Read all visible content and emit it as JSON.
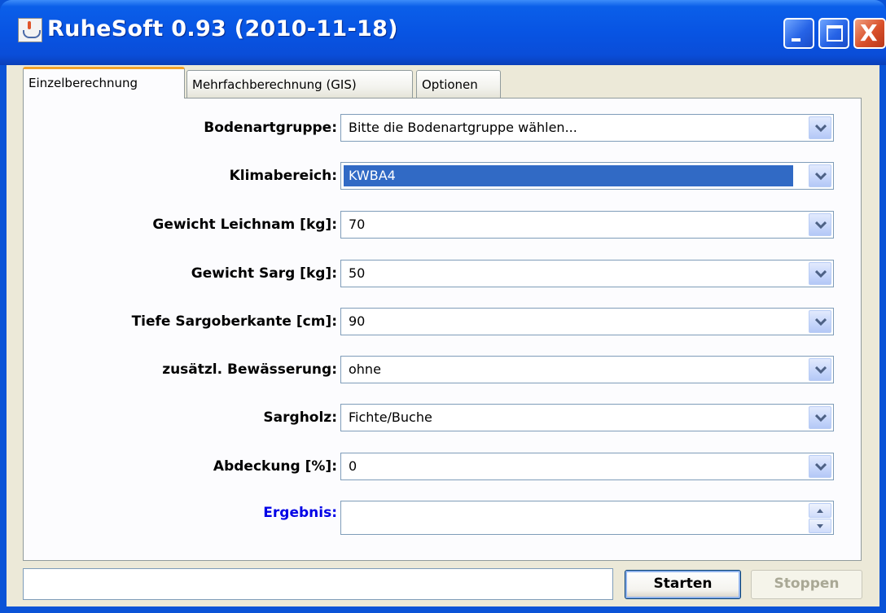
{
  "window": {
    "title": "RuheSoft 0.93 (2010-11-18)",
    "icon": "java-cup-icon",
    "controls": [
      "minimize",
      "maximize",
      "close"
    ],
    "close_glyph": "X"
  },
  "tabs": [
    {
      "label": "Einzelberechnung",
      "active": true
    },
    {
      "label": "Mehrfachberechnung (GIS)",
      "active": false
    },
    {
      "label": "Optionen",
      "active": false
    }
  ],
  "form": {
    "bodenartgruppe": {
      "label": "Bodenartgruppe:",
      "value": "Bitte die Bodenartgruppe wählen..."
    },
    "klimabereich": {
      "label": "Klimabereich:",
      "value": "KWBA4"
    },
    "gewicht_leichnam": {
      "label": "Gewicht Leichnam [kg]:",
      "value": "70"
    },
    "gewicht_sarg": {
      "label": "Gewicht Sarg [kg]:",
      "value": "50"
    },
    "tiefe_sargoberkante": {
      "label": "Tiefe Sargoberkante [cm]:",
      "value": "90"
    },
    "bewaesserung": {
      "label": "zusätzl. Bewässerung:",
      "value": "ohne"
    },
    "sargholz": {
      "label": "Sargholz:",
      "value": "Fichte/Buche"
    },
    "abdeckung": {
      "label": "Abdeckung [%]:",
      "value": "0"
    },
    "ergebnis": {
      "label": "Ergebnis:",
      "value": ""
    }
  },
  "footer": {
    "status_text": "",
    "start_label": "Starten",
    "stop_label": "Stoppen",
    "stop_enabled": false
  },
  "colors": {
    "titlebar": "#0a53d7",
    "selection": "#316ac5",
    "active_tab_accent": "#f3a32b",
    "ergebnis_label": "#0000e6",
    "disabled_text": "#a9a895"
  }
}
